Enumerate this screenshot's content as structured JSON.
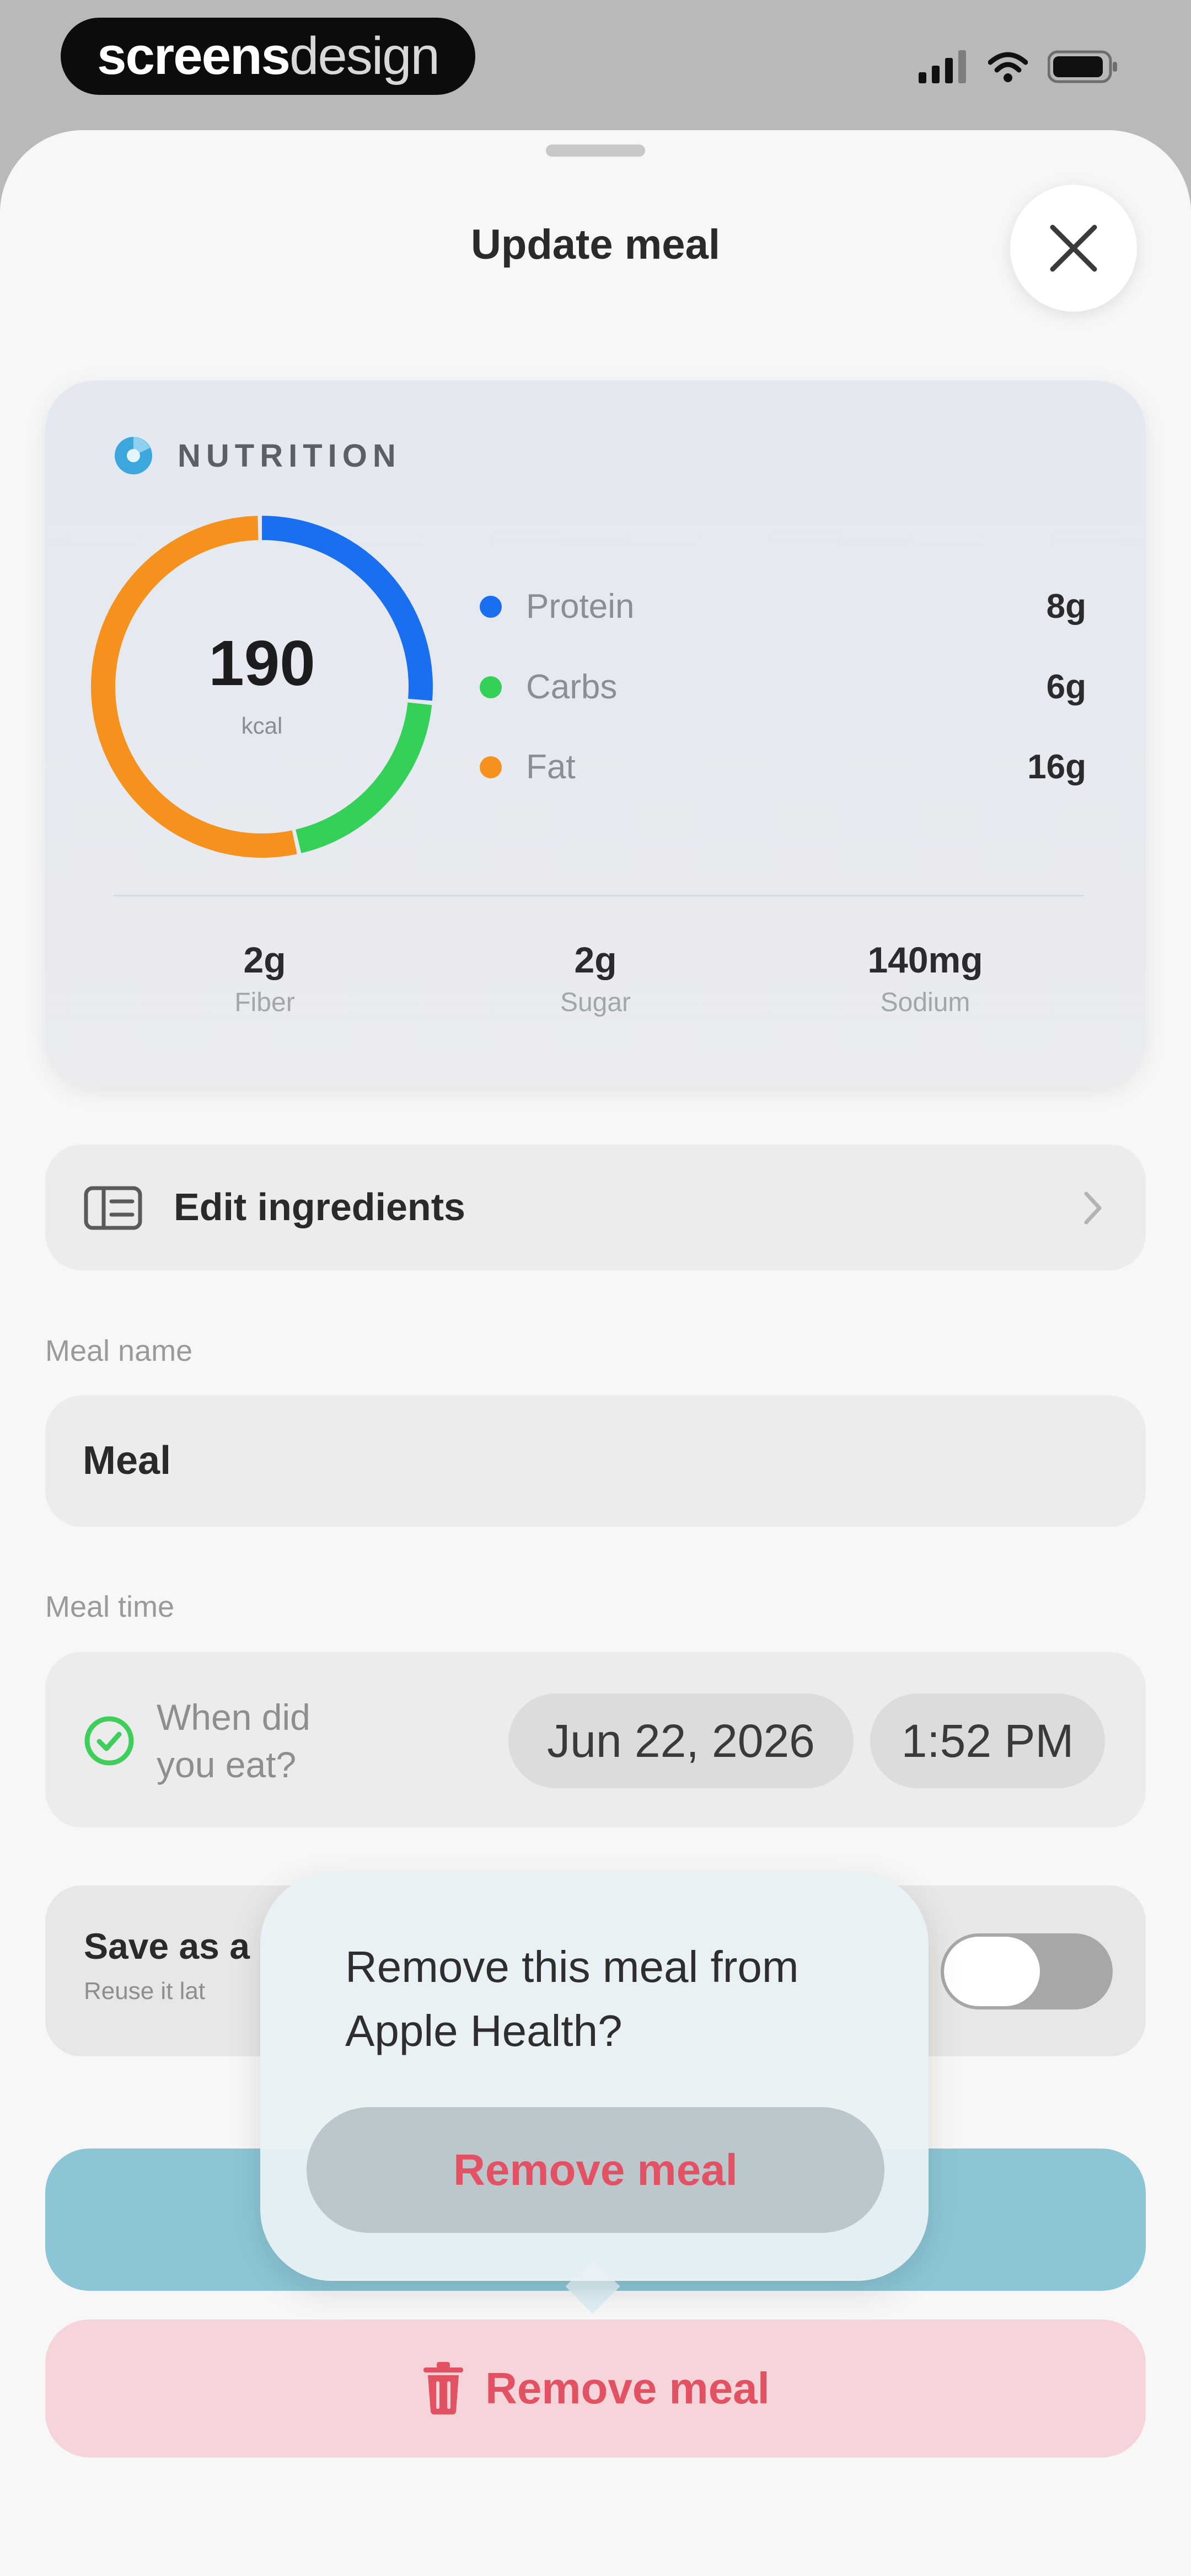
{
  "status_bar": {
    "brand_bold": "screens",
    "brand_light": "design"
  },
  "sheet": {
    "title": "Update meal"
  },
  "nutrition": {
    "section_label": "NUTRITION",
    "calories_value": "190",
    "calories_unit": "kcal",
    "macros": [
      {
        "name": "Protein",
        "value": "8g",
        "color": "#1a6ff0",
        "fraction": 0.267
      },
      {
        "name": "Carbs",
        "value": "6g",
        "color": "#34d058",
        "fraction": 0.2
      },
      {
        "name": "Fat",
        "value": "16g",
        "color": "#f5921e",
        "fraction": 0.533
      }
    ],
    "stats": [
      {
        "value": "2g",
        "label": "Fiber"
      },
      {
        "value": "2g",
        "label": "Sugar"
      },
      {
        "value": "140mg",
        "label": "Sodium"
      }
    ]
  },
  "edit_ingredients": {
    "label": "Edit ingredients"
  },
  "meal_name": {
    "label": "Meal name",
    "value": "Meal"
  },
  "meal_time": {
    "label": "Meal time",
    "prompt_line1": "When did",
    "prompt_line2": "you eat?",
    "date": "Jun 22, 2026",
    "time": "1:52 PM"
  },
  "save_favorite": {
    "title": "Save as a",
    "subtitle": "Reuse it lat",
    "toggle_on": false
  },
  "popover": {
    "line1": "Remove this meal from",
    "line2": "Apple Health?",
    "button_label": "Remove meal"
  },
  "remove_button": {
    "label": "Remove meal"
  },
  "colors": {
    "accent_blue": "#8cc6d6",
    "destructive": "#e35263",
    "confirm_green": "#3dcf5a"
  }
}
